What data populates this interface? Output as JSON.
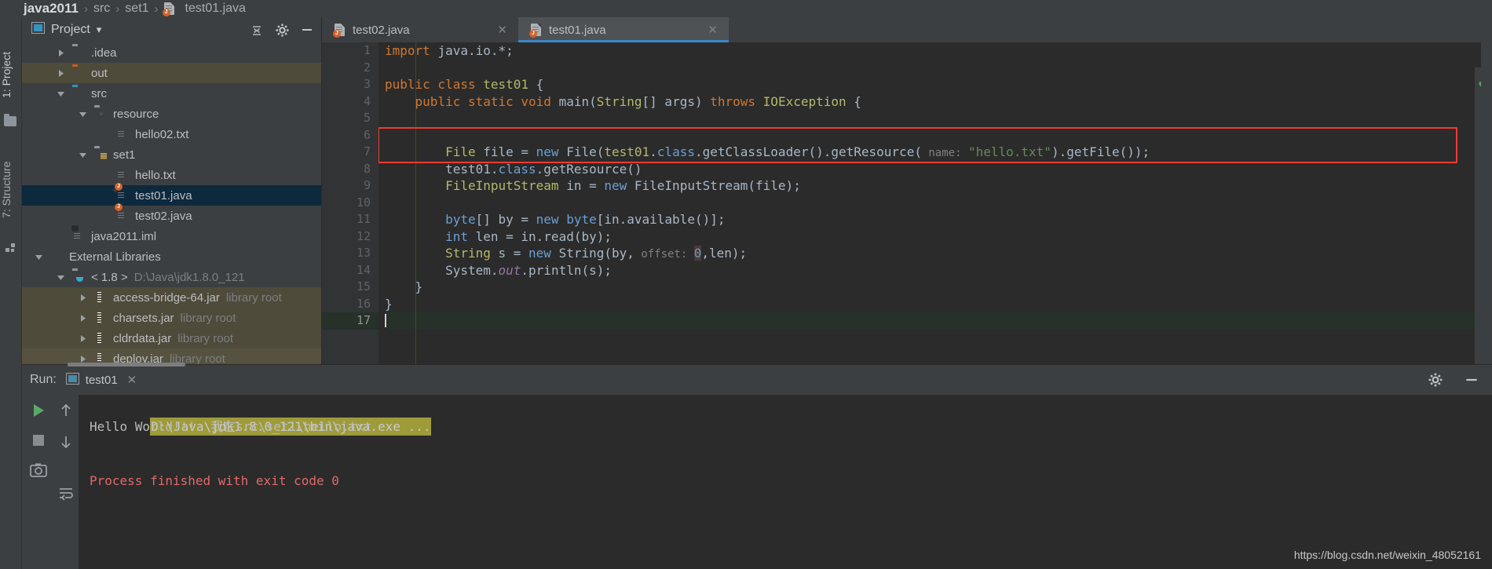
{
  "breadcrumb": {
    "items": [
      "java2011",
      "src",
      "set1",
      "test01.java"
    ],
    "separator": "›"
  },
  "left_strip": {
    "project_tab": "1: Project",
    "structure_tab": "7: Structure"
  },
  "project_panel": {
    "title": "Project",
    "chevron": "▾",
    "collapse_all_icon": "collapse-all-icon",
    "settings_icon": "gear-icon",
    "hide_icon": "minimize-icon",
    "tree": [
      {
        "label": ".idea",
        "sub": "",
        "indent": 1,
        "arrow": "right",
        "icon": "folder-gray",
        "state": "normal"
      },
      {
        "label": "out",
        "sub": "",
        "indent": 1,
        "arrow": "right",
        "icon": "folder-orange",
        "state": "highlight"
      },
      {
        "label": "src",
        "sub": "",
        "indent": 1,
        "arrow": "down",
        "icon": "folder-blue",
        "state": "normal"
      },
      {
        "label": "resource",
        "sub": "",
        "indent": 2,
        "arrow": "down",
        "icon": "folder-res",
        "state": "normal"
      },
      {
        "label": "hello02.txt",
        "sub": "",
        "indent": 3,
        "arrow": "none",
        "icon": "file-text",
        "state": "normal"
      },
      {
        "label": "set1",
        "sub": "",
        "indent": 2,
        "arrow": "down",
        "icon": "folder-pkg",
        "state": "normal"
      },
      {
        "label": "hello.txt",
        "sub": "",
        "indent": 3,
        "arrow": "none",
        "icon": "file-text",
        "state": "normal"
      },
      {
        "label": "test01.java",
        "sub": "",
        "indent": 3,
        "arrow": "none",
        "icon": "file-java",
        "state": "selected"
      },
      {
        "label": "test02.java",
        "sub": "",
        "indent": 3,
        "arrow": "none",
        "icon": "file-java",
        "state": "normal"
      },
      {
        "label": "java2011.iml",
        "sub": "",
        "indent": 1,
        "arrow": "none",
        "icon": "file-iml",
        "state": "normal"
      },
      {
        "label": "External Libraries",
        "sub": "",
        "indent": 0,
        "arrow": "down",
        "icon": "library-bars",
        "state": "normal"
      },
      {
        "label": "< 1.8 >",
        "sub": "D:\\Java\\jdk1.8.0_121",
        "indent": 1,
        "arrow": "down",
        "icon": "folder-jdk",
        "state": "normal"
      },
      {
        "label": "access-bridge-64.jar",
        "sub": "library root",
        "indent": 2,
        "arrow": "right",
        "icon": "jar",
        "state": "highlight"
      },
      {
        "label": "charsets.jar",
        "sub": "library root",
        "indent": 2,
        "arrow": "right",
        "icon": "jar",
        "state": "highlight"
      },
      {
        "label": "cldrdata.jar",
        "sub": "library root",
        "indent": 2,
        "arrow": "right",
        "icon": "jar",
        "state": "highlight"
      },
      {
        "label": "deploy.jar",
        "sub": "library root",
        "indent": 2,
        "arrow": "right",
        "icon": "jar",
        "state": "highlight2"
      }
    ]
  },
  "editor": {
    "tabs": [
      {
        "label": "test02.java",
        "active": false,
        "close": "✕"
      },
      {
        "label": "test01.java",
        "active": true,
        "close": "✕"
      }
    ],
    "line_numbers": [
      "1",
      "2",
      "3",
      "4",
      "5",
      "6",
      "7",
      "8",
      "9",
      "10",
      "11",
      "12",
      "13",
      "14",
      "15",
      "16",
      "17"
    ],
    "current_line": 17,
    "run_markers": [
      3,
      4
    ],
    "inspection_status": "✔",
    "lines": [
      {
        "n": 1,
        "tokens": [
          {
            "t": "import ",
            "c": "kw"
          },
          {
            "t": "java.io.*;",
            "c": "plain"
          }
        ]
      },
      {
        "n": 2,
        "tokens": []
      },
      {
        "n": 3,
        "tokens": [
          {
            "t": "public class ",
            "c": "kw"
          },
          {
            "t": "test01",
            "c": "cls"
          },
          {
            "t": " {",
            "c": "plain"
          }
        ]
      },
      {
        "n": 4,
        "tokens": [
          {
            "t": "    ",
            "c": "plain"
          },
          {
            "t": "public static void ",
            "c": "kw"
          },
          {
            "t": "main",
            "c": "plain"
          },
          {
            "t": "(",
            "c": "plain"
          },
          {
            "t": "String",
            "c": "cls"
          },
          {
            "t": "[] args) ",
            "c": "plain"
          },
          {
            "t": "throws ",
            "c": "kw"
          },
          {
            "t": "IOException",
            "c": "cls"
          },
          {
            "t": " {",
            "c": "plain"
          }
        ]
      },
      {
        "n": 5,
        "tokens": []
      },
      {
        "n": 6,
        "tokens": []
      },
      {
        "n": 7,
        "tokens": [
          {
            "t": "        ",
            "c": "plain"
          },
          {
            "t": "File",
            "c": "cls"
          },
          {
            "t": " file = ",
            "c": "plain"
          },
          {
            "t": "new ",
            "c": "kw2"
          },
          {
            "t": "File",
            "c": "plain"
          },
          {
            "t": "(",
            "c": "plain"
          },
          {
            "t": "test01",
            "c": "cls"
          },
          {
            "t": ".",
            "c": "plain"
          },
          {
            "t": "class",
            "c": "kw2"
          },
          {
            "t": ".getClassLoader().getResource(",
            "c": "plain"
          },
          {
            "t": " name: ",
            "c": "hint"
          },
          {
            "t": "\"hello.txt\"",
            "c": "str"
          },
          {
            "t": ").getFile());",
            "c": "plain"
          }
        ]
      },
      {
        "n": 8,
        "tokens": [
          {
            "t": "        test01.",
            "c": "plain"
          },
          {
            "t": "class",
            "c": "kw2"
          },
          {
            "t": ".getResource()",
            "c": "plain"
          }
        ]
      },
      {
        "n": 9,
        "tokens": [
          {
            "t": "        ",
            "c": "plain"
          },
          {
            "t": "FileInputStream",
            "c": "cls"
          },
          {
            "t": " in = ",
            "c": "plain"
          },
          {
            "t": "new ",
            "c": "kw2"
          },
          {
            "t": "FileInputStream",
            "c": "plain"
          },
          {
            "t": "(file);",
            "c": "plain"
          }
        ]
      },
      {
        "n": 10,
        "tokens": []
      },
      {
        "n": 11,
        "tokens": [
          {
            "t": "        ",
            "c": "plain"
          },
          {
            "t": "byte",
            "c": "kw2"
          },
          {
            "t": "[] by = ",
            "c": "plain"
          },
          {
            "t": "new ",
            "c": "kw2"
          },
          {
            "t": "byte",
            "c": "kw2"
          },
          {
            "t": "[in.available()];",
            "c": "plain"
          }
        ]
      },
      {
        "n": 12,
        "tokens": [
          {
            "t": "        ",
            "c": "plain"
          },
          {
            "t": "int",
            "c": "kw2"
          },
          {
            "t": " len = in.read(by);",
            "c": "plain"
          }
        ]
      },
      {
        "n": 13,
        "tokens": [
          {
            "t": "        ",
            "c": "plain"
          },
          {
            "t": "String",
            "c": "cls"
          },
          {
            "t": " s = ",
            "c": "plain"
          },
          {
            "t": "new ",
            "c": "kw2"
          },
          {
            "t": "String",
            "c": "plain"
          },
          {
            "t": "(by,",
            "c": "plain"
          },
          {
            "t": " offset: ",
            "c": "hint"
          },
          {
            "t": "0",
            "c": "numbox"
          },
          {
            "t": ",len);",
            "c": "plain"
          }
        ]
      },
      {
        "n": 14,
        "tokens": [
          {
            "t": "        System.",
            "c": "plain"
          },
          {
            "t": "out",
            "c": "fld"
          },
          {
            "t": ".println(s);",
            "c": "plain"
          }
        ]
      },
      {
        "n": 15,
        "tokens": [
          {
            "t": "    }",
            "c": "plain"
          }
        ]
      },
      {
        "n": 16,
        "tokens": [
          {
            "t": "}",
            "c": "plain"
          }
        ]
      },
      {
        "n": 17,
        "tokens": []
      }
    ],
    "highlight_box": {
      "line": 7,
      "label": "red-highlight-box"
    }
  },
  "run_panel": {
    "label": "Run:",
    "tab_label": "test01",
    "tab_close": "✕",
    "settings_icon": "gear-icon",
    "hide_icon": "minimize-icon",
    "toolbar": {
      "run_icon": "run-green-arrow-icon",
      "stop_icon": "stop-square-icon",
      "camera_icon": "camera-icon",
      "up_icon": "arrow-up-icon",
      "down_icon": "arrow-down-icon",
      "wrap_icon": "soft-wrap-icon"
    },
    "console": {
      "command": "D:\\Java\\jdk1.8.0_121\\bin\\java.exe ...",
      "output": "Hello World!!!  我在src\\set1\\hello.txt",
      "exit": "Process finished with exit code 0"
    }
  },
  "watermark": "https://blog.csdn.net/weixin_48052161",
  "colors": {
    "accent_blue": "#3d86c9",
    "selection": "#0d293e",
    "highlight_row": "#4e4b3b",
    "error_red": "#ef3b2f",
    "run_green": "#59a869",
    "console_cmd_bg": "#9e9b39"
  }
}
